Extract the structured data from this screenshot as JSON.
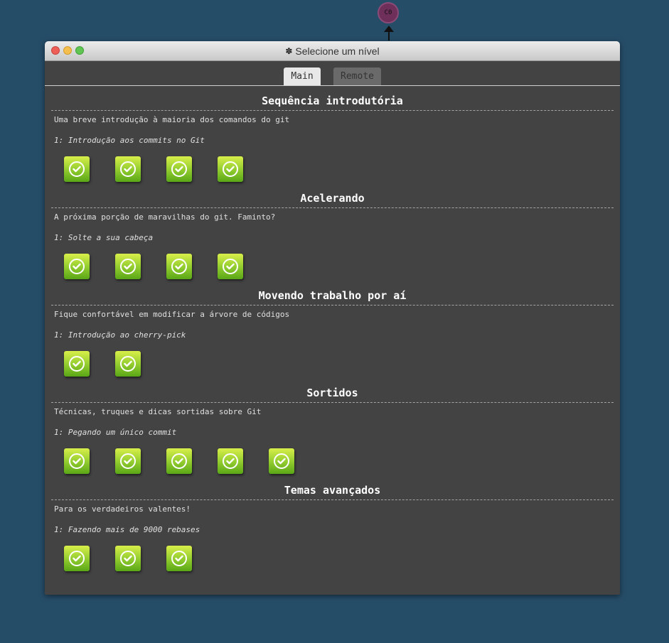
{
  "commit_node": {
    "label": "C0"
  },
  "window": {
    "title": "Selecione um nível",
    "title_icon": "gear-icon"
  },
  "tabs": [
    {
      "label": "Main",
      "selected": true
    },
    {
      "label": "Remote",
      "selected": false
    }
  ],
  "sections": [
    {
      "title": "Sequência introdutória",
      "description": "Uma breve introdução à maioria dos comandos do git",
      "current_level": "1: Introdução aos commits no Git",
      "levels": [
        {
          "icon": "check-icon",
          "completed": true
        },
        {
          "icon": "check-icon",
          "completed": true
        },
        {
          "icon": "check-icon",
          "completed": true
        },
        {
          "icon": "check-icon",
          "completed": true
        }
      ]
    },
    {
      "title": "Acelerando",
      "description": "A próxima porção de maravilhas do git. Faminto?",
      "current_level": "1: Solte a sua cabeça",
      "levels": [
        {
          "icon": "check-icon",
          "completed": true
        },
        {
          "icon": "check-icon",
          "completed": true
        },
        {
          "icon": "check-icon",
          "completed": true
        },
        {
          "icon": "check-icon",
          "completed": true
        }
      ]
    },
    {
      "title": "Movendo trabalho por aí",
      "description": "Fique confortável em modificar a árvore de códigos",
      "current_level": "1: Introdução ao cherry-pick",
      "levels": [
        {
          "icon": "check-icon",
          "completed": true
        },
        {
          "icon": "check-icon",
          "completed": true
        }
      ]
    },
    {
      "title": "Sortidos",
      "description": "Técnicas, truques e dicas sortidas sobre Git",
      "current_level": "1: Pegando um único commit",
      "levels": [
        {
          "icon": "check-icon",
          "completed": true
        },
        {
          "icon": "check-icon",
          "completed": true
        },
        {
          "icon": "check-icon",
          "completed": true
        },
        {
          "icon": "check-icon",
          "completed": true
        },
        {
          "icon": "check-icon",
          "completed": true
        }
      ]
    },
    {
      "title": "Temas avançados",
      "description": "Para os verdadeiros valentes!",
      "current_level": "1: Fazendo mais de 9000 rebases",
      "levels": [
        {
          "icon": "check-icon",
          "completed": true
        },
        {
          "icon": "check-icon",
          "completed": true
        },
        {
          "icon": "check-icon",
          "completed": true
        }
      ]
    }
  ],
  "colors": {
    "background": "#264d68",
    "window_body": "#434343",
    "commit_node": "#6e2f5a",
    "level_button": "#8cc63f"
  }
}
